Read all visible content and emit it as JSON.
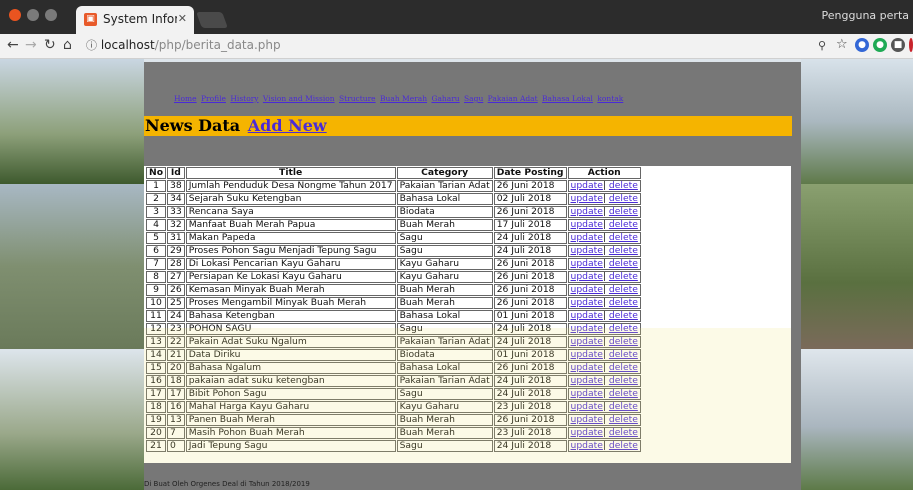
{
  "browser": {
    "tab_title": "System Information",
    "url_host": "localhost",
    "url_path": "/php/berita_data.php",
    "user_label": "Pengguna perta"
  },
  "menu": [
    "Home",
    "Profile",
    "History",
    "Vision and Mission",
    "Structure",
    "Buah Merah",
    "Gaharu",
    "Sagu",
    "Pakaian Adat",
    "Bahasa Lokal",
    "kontak"
  ],
  "banner": {
    "title": "News Data",
    "add_new": "Add New"
  },
  "table": {
    "headers": [
      "No",
      "Id",
      "Title",
      "Category",
      "Date Posting",
      "Action"
    ],
    "action_update": "update",
    "action_delete": "delete",
    "rows": [
      [
        "1",
        "38",
        "Jumlah Penduduk Desa Nongme Tahun 2017",
        "Pakaian Tarian Adat",
        "26 Juni 2018"
      ],
      [
        "2",
        "34",
        "Sejarah Suku Ketengban",
        "Bahasa Lokal",
        "02 Juli 2018"
      ],
      [
        "3",
        "33",
        "Rencana Saya",
        "Biodata",
        "26 Juni 2018"
      ],
      [
        "4",
        "32",
        "Manfaat Buah Merah Papua",
        "Buah Merah",
        "17 Juli 2018"
      ],
      [
        "5",
        "31",
        "Makan Papeda",
        "Sagu",
        "24 Juli 2018"
      ],
      [
        "6",
        "29",
        "Proses Pohon Sagu Menjadi Tepung Sagu",
        "Sagu",
        "24 Juli 2018"
      ],
      [
        "7",
        "28",
        "Di Lokasi Pencarian Kayu Gaharu",
        "Kayu Gaharu",
        "26 Juni 2018"
      ],
      [
        "8",
        "27",
        "Persiapan Ke Lokasi Kayu Gaharu",
        "Kayu Gaharu",
        "26 Juni 2018"
      ],
      [
        "9",
        "26",
        "Kemasan Minyak Buah Merah",
        "Buah Merah",
        "26 Juni 2018"
      ],
      [
        "10",
        "25",
        "Proses Mengambil Minyak Buah Merah",
        "Buah Merah",
        "26 Juni 2018"
      ],
      [
        "11",
        "24",
        "Bahasa Ketengban",
        "Bahasa Lokal",
        "01 Juni 2018"
      ],
      [
        "12",
        "23",
        "POHON SAGU",
        "Sagu",
        "24 Juli 2018"
      ],
      [
        "13",
        "22",
        "Pakain Adat Suku Ngalum",
        "Pakaian Tarian Adat",
        "24 Juli 2018"
      ],
      [
        "14",
        "21",
        "Data Diriku",
        "Biodata",
        "01 Juni 2018"
      ],
      [
        "15",
        "20",
        "Bahasa Ngalum",
        "Bahasa Lokal",
        "26 Juni 2018"
      ],
      [
        "16",
        "18",
        "pakaian adat suku ketengban",
        "Pakaian Tarian Adat",
        "24 Juli 2018"
      ],
      [
        "17",
        "17",
        "Bibit Pohon Sagu",
        "Sagu",
        "24 Juli 2018"
      ],
      [
        "18",
        "16",
        "Mahal Harga Kayu Gaharu",
        "Kayu Gaharu",
        "23 Juli 2018"
      ],
      [
        "19",
        "13",
        "Panen Buah Merah",
        "Buah Merah",
        "26 Juni 2018"
      ],
      [
        "20",
        "7",
        "Masih Pohon Buah Merah",
        "Buah Merah",
        "23 Juli 2018"
      ],
      [
        "21",
        "0",
        "Jadi Tepung Sagu",
        "Sagu",
        "24 Juli 2018"
      ]
    ]
  },
  "footer": "Di Buat Oleh Orgenes Deal di Tahun 2018/2019",
  "colors": {
    "banner": "#f5b400",
    "panel": "#777777",
    "link": "#4a2bd6"
  }
}
